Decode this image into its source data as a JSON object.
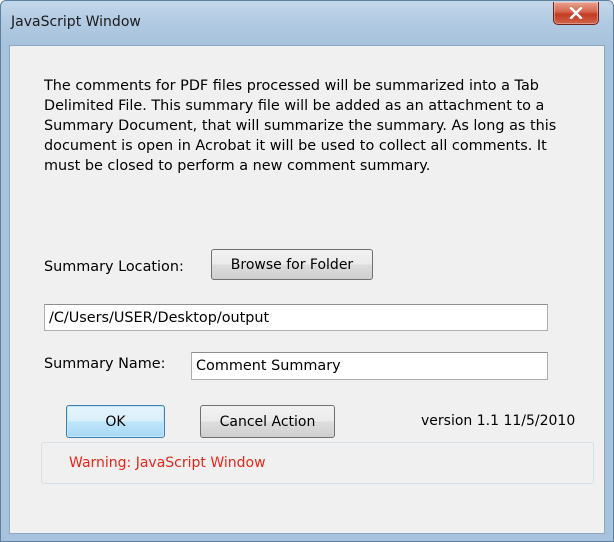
{
  "window": {
    "title": "JavaScript Window",
    "close_icon": "close-icon"
  },
  "description": "The comments for PDF files processed will be summarized into a Tab Delimited File. This summary file will be added as an attachment to a Summary Document, that will summarize the summary. As long as this document is open in Acrobat it will be used to collect all comments.  It must be closed to perform a new comment summary.",
  "location": {
    "label": "Summary Location:",
    "browse_button": "Browse for Folder",
    "path_value": "/C/Users/USER/Desktop/output"
  },
  "name": {
    "label": "Summary Name:",
    "value": "Comment Summary"
  },
  "actions": {
    "ok_label": "OK",
    "cancel_label": "Cancel Action",
    "version_text": "version 1.1  11/5/2010"
  },
  "warning": {
    "text": "Warning: JavaScript Window",
    "color": "#e8261a"
  },
  "colors": {
    "frame": "#a7c2dd",
    "client": "#f0f0f0",
    "close_button": "#c23c22"
  }
}
